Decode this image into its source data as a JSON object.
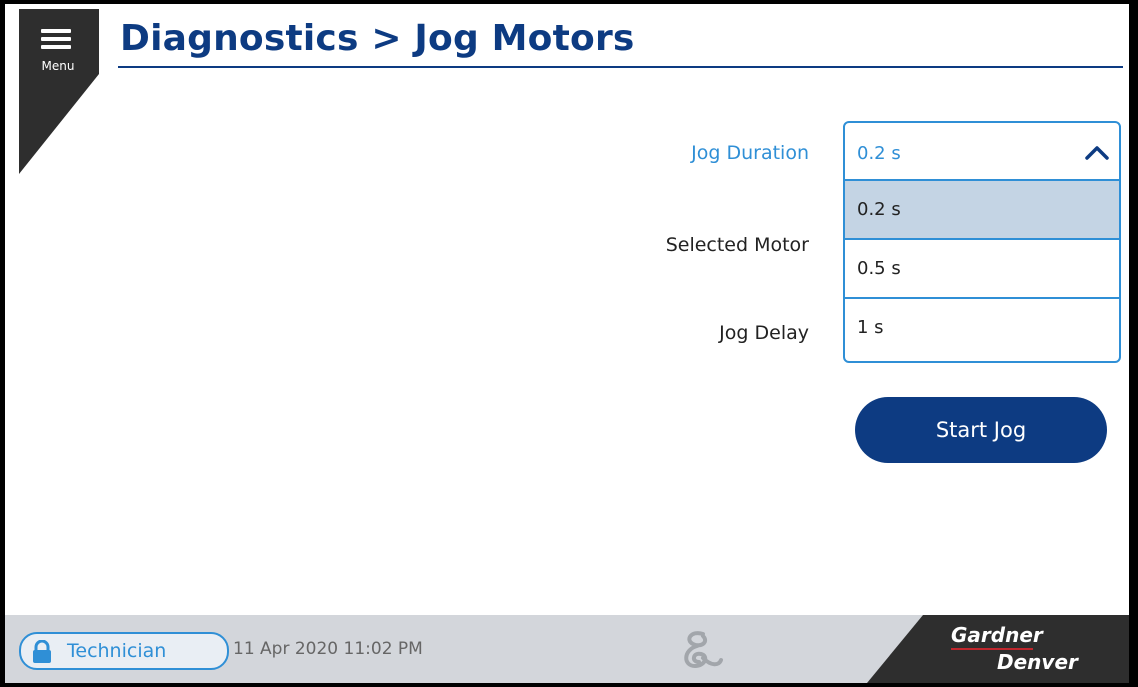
{
  "menu": {
    "label": "Menu"
  },
  "header": {
    "breadcrumb": "Diagnostics > Jog Motors"
  },
  "form": {
    "jog_duration_label": "Jog Duration",
    "selected_motor_label": "Selected Motor",
    "jog_delay_label": "Jog Delay"
  },
  "dropdown": {
    "value": "0.2 s",
    "options": [
      {
        "label": "0.2 s",
        "selected": true
      },
      {
        "label": "0.5 s",
        "selected": false
      },
      {
        "label": "1 s",
        "selected": false
      }
    ]
  },
  "actions": {
    "start_jog": "Start Jog"
  },
  "footer": {
    "user": "Technician",
    "datetime": "11 Apr 2020  11:02 PM",
    "brand_line1": "Gardner",
    "brand_line2": "Denver"
  },
  "colors": {
    "primary": "#0d3b82",
    "accent": "#2f8fd6",
    "selected_option": "#c4d4e4",
    "footer_bg": "#d3d6db",
    "dark_panel": "#2e2e2e"
  },
  "icons": [
    "hamburger-menu-icon",
    "chevron-up-icon",
    "lock-icon",
    "swirl-logo-icon"
  ]
}
